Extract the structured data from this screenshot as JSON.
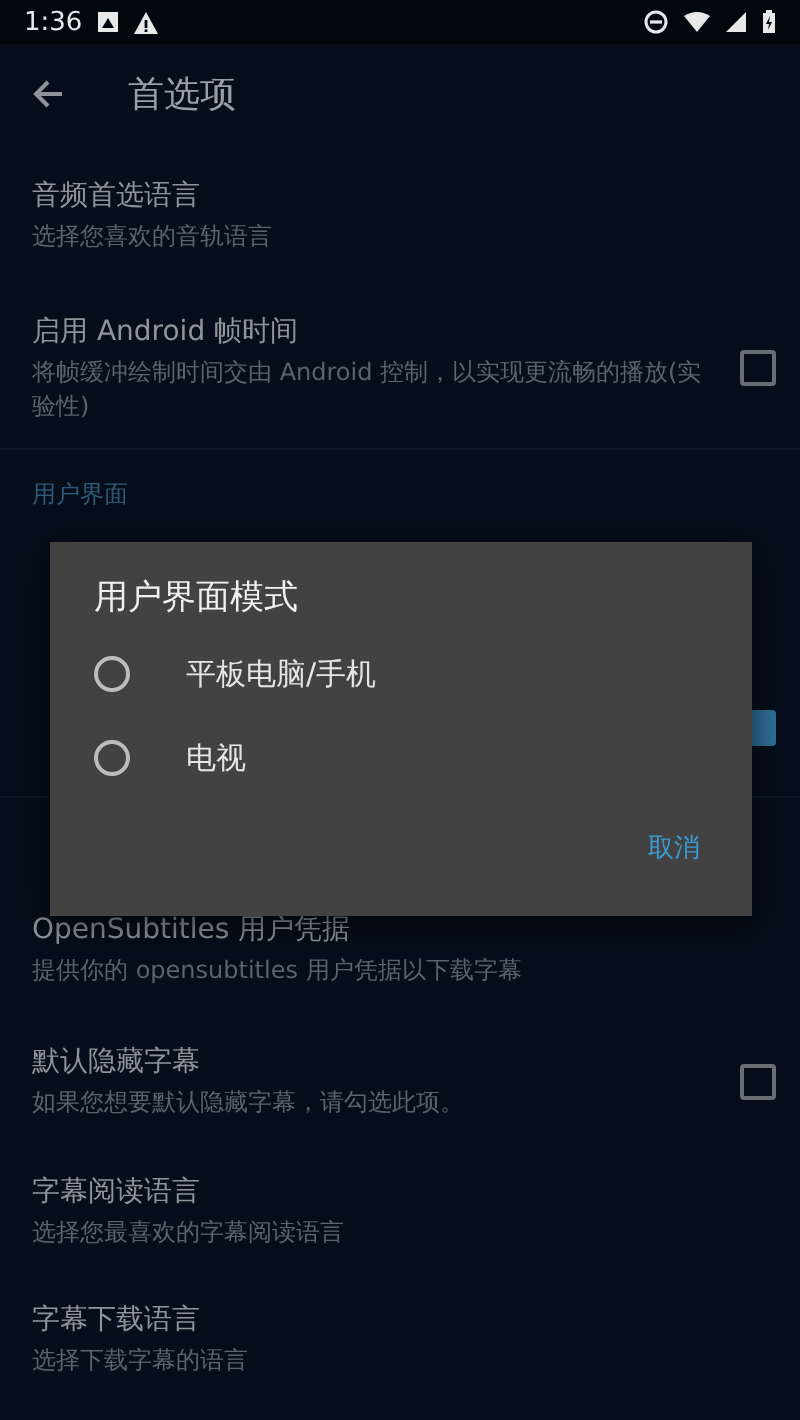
{
  "status_bar": {
    "time": "1:36"
  },
  "app_bar": {
    "title": "首选项"
  },
  "list": [
    {
      "kind": "row",
      "title": "音频首选语言",
      "subtitle": "选择您喜欢的音轨语言"
    },
    {
      "kind": "row",
      "title": "启用 Android 帧时间",
      "subtitle": "将帧缓冲绘制时间交由 Android 控制，以实现更流畅的播放(实验性)",
      "checked": false
    },
    {
      "kind": "header",
      "title": "用户界面"
    },
    {
      "kind": "row"
    },
    {
      "kind": "row",
      "checked": true
    },
    {
      "kind": "header"
    },
    {
      "kind": "row",
      "title": "OpenSubtitles 用户凭据",
      "subtitle": "提供你的 opensubtitles 用户凭据以下载字幕"
    },
    {
      "kind": "row",
      "title": "默认隐藏字幕",
      "subtitle": "如果您想要默认隐藏字幕，请勾选此项。",
      "checked": false
    },
    {
      "kind": "row",
      "title": "字幕阅读语言",
      "subtitle": "选择您最喜欢的字幕阅读语言"
    },
    {
      "kind": "row",
      "title": "字幕下载语言",
      "subtitle": "选择下载字幕的语言"
    }
  ],
  "dialog": {
    "title": "用户界面模式",
    "options": [
      {
        "label": "平板电脑/手机",
        "selected": false
      },
      {
        "label": "电视",
        "selected": false
      }
    ],
    "button": "取消"
  }
}
